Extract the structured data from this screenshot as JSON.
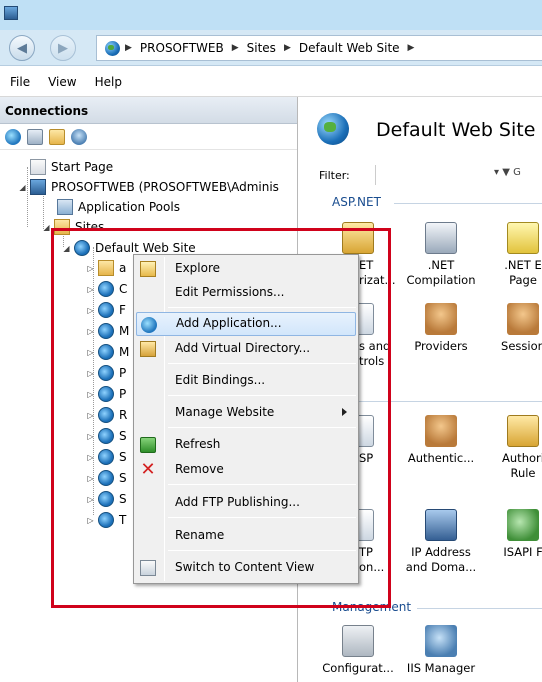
{
  "addressbar": {
    "segments": [
      "PROSOFTWEB",
      "Sites",
      "Default Web Site"
    ]
  },
  "menubar": {
    "items": [
      "File",
      "View",
      "Help"
    ]
  },
  "connections": {
    "header": "Connections",
    "tree": {
      "start_page": "Start Page",
      "server": "PROSOFTWEB (PROSOFTWEB\\Adminis",
      "app_pools": "Application Pools",
      "sites": "Sites",
      "default_site": "Default Web Site",
      "children": [
        "a",
        "C",
        "F",
        "M",
        "M",
        "P",
        "P",
        "R",
        "S",
        "S",
        "S",
        "S",
        "T"
      ]
    }
  },
  "main": {
    "title": "Default Web Site",
    "filter_label": "Filter:",
    "filter_go": "G",
    "group_aspnet": "ASP.NET",
    "group_management": "Management",
    "features": {
      "r1c1": ".NET\nAuthorizat...",
      "r1c2": ".NET\nCompilation",
      "r1c3": ".NET E\nPage",
      "r2c1": "Pages and\nControls",
      "r2c2": "Providers",
      "r2c3": "Session",
      "r3c1": "ASP",
      "r3c2": "Authentic...",
      "r3c3": "Authori\nRule",
      "r4c1": "FTP\nSession...",
      "r4c2": "IP Address\nand Doma...",
      "r4c3": "ISAPI F",
      "r5c1": "Configurat...",
      "r5c2": "IIS Manager"
    },
    "visible_text": {
      "r1c1": "ET\nrizat...",
      "r2c1": "s and\ntrols",
      "r3c1": "SP",
      "r4c1": "TP\non..."
    }
  },
  "context_menu": {
    "items": {
      "explore": "Explore",
      "edit_permissions": "Edit Permissions...",
      "add_application": "Add Application...",
      "add_virtual_directory": "Add Virtual Directory...",
      "edit_bindings": "Edit Bindings...",
      "manage_website": "Manage Website",
      "refresh": "Refresh",
      "remove": "Remove",
      "add_ftp_publishing": "Add FTP Publishing...",
      "rename": "Rename",
      "switch_to_content_view": "Switch to Content View"
    },
    "highlighted": "Add Application..."
  },
  "colors": {
    "highlight_box": "#d0021b",
    "menu_hover": "#d2e6fb",
    "group_label": "#1a4d8f"
  }
}
